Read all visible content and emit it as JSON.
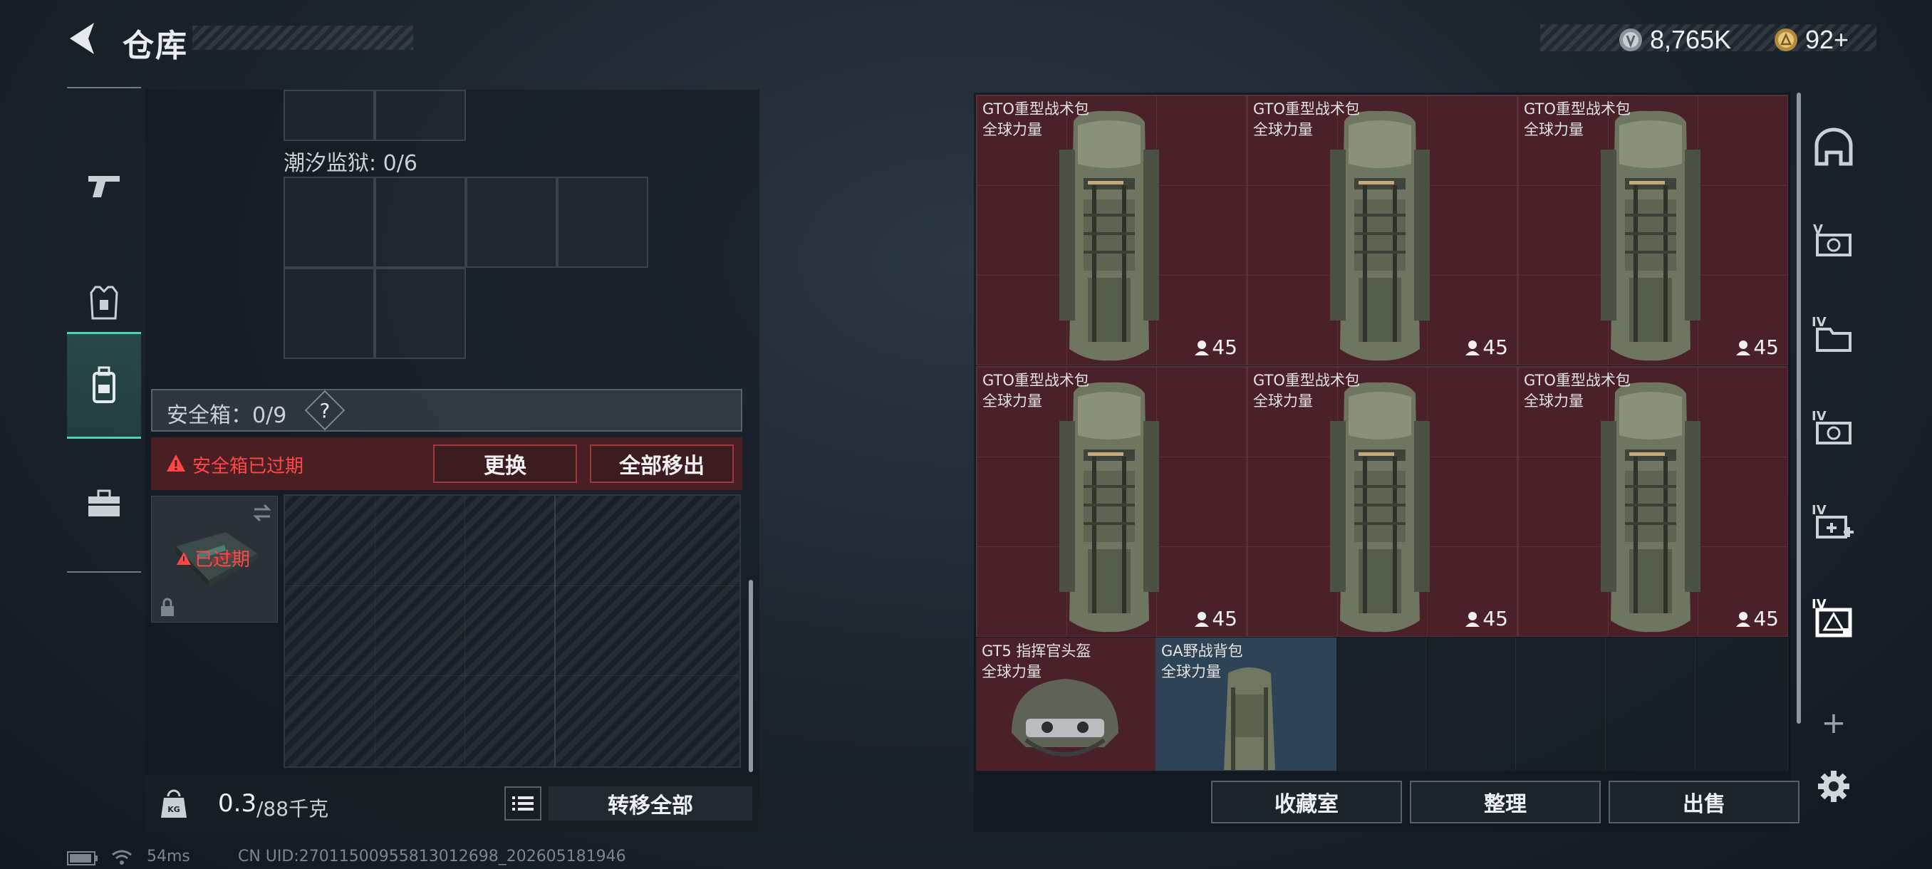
{
  "header": {
    "title": "仓库",
    "currency_1": "8,765K",
    "currency_2": "92+"
  },
  "side_nav": {
    "items": [
      {
        "name": "weapon-icon"
      },
      {
        "name": "armor-vest-icon"
      },
      {
        "name": "backpack-icon"
      },
      {
        "name": "toolbox-icon"
      }
    ],
    "active_index": 2
  },
  "left_panel": {
    "prison_label": "潮汐监狱: 0/6",
    "safebox_label": "安全箱：0/9",
    "help_symbol": "?",
    "warning_text": "安全箱已过期",
    "replace_button": "更换",
    "move_all_out_button": "全部移出",
    "expired_badge": "已过期",
    "weight_current": "0.3",
    "weight_total": "/88千克",
    "transfer_all_button": "转移全部"
  },
  "items": [
    {
      "name": "GTO重型战术包",
      "sub": "全球力量",
      "count": "45"
    },
    {
      "name": "GTO重型战术包",
      "sub": "全球力量",
      "count": "45"
    },
    {
      "name": "GTO重型战术包",
      "sub": "全球力量",
      "count": "45"
    },
    {
      "name": "GTO重型战术包",
      "sub": "全球力量",
      "count": "45"
    },
    {
      "name": "GTO重型战术包",
      "sub": "全球力量",
      "count": "45"
    },
    {
      "name": "GTO重型战术包",
      "sub": "全球力量",
      "count": "45"
    }
  ],
  "small_items": [
    {
      "name": "GT5 指挥官头盔",
      "sub": "全球力量"
    },
    {
      "name": "GA野战背包",
      "sub": "全球力量"
    }
  ],
  "right_nav": {
    "add_symbol": "+"
  },
  "bottom_buttons": {
    "collection": "收藏室",
    "organize": "整理",
    "sell": "出售"
  },
  "status": {
    "ping": "54ms",
    "uid": "CN UID:27011500955813012698_202605181946"
  },
  "colors": {
    "accent": "#45d6b4",
    "warning": "#ff4747",
    "item_bg": "#4a2128"
  }
}
